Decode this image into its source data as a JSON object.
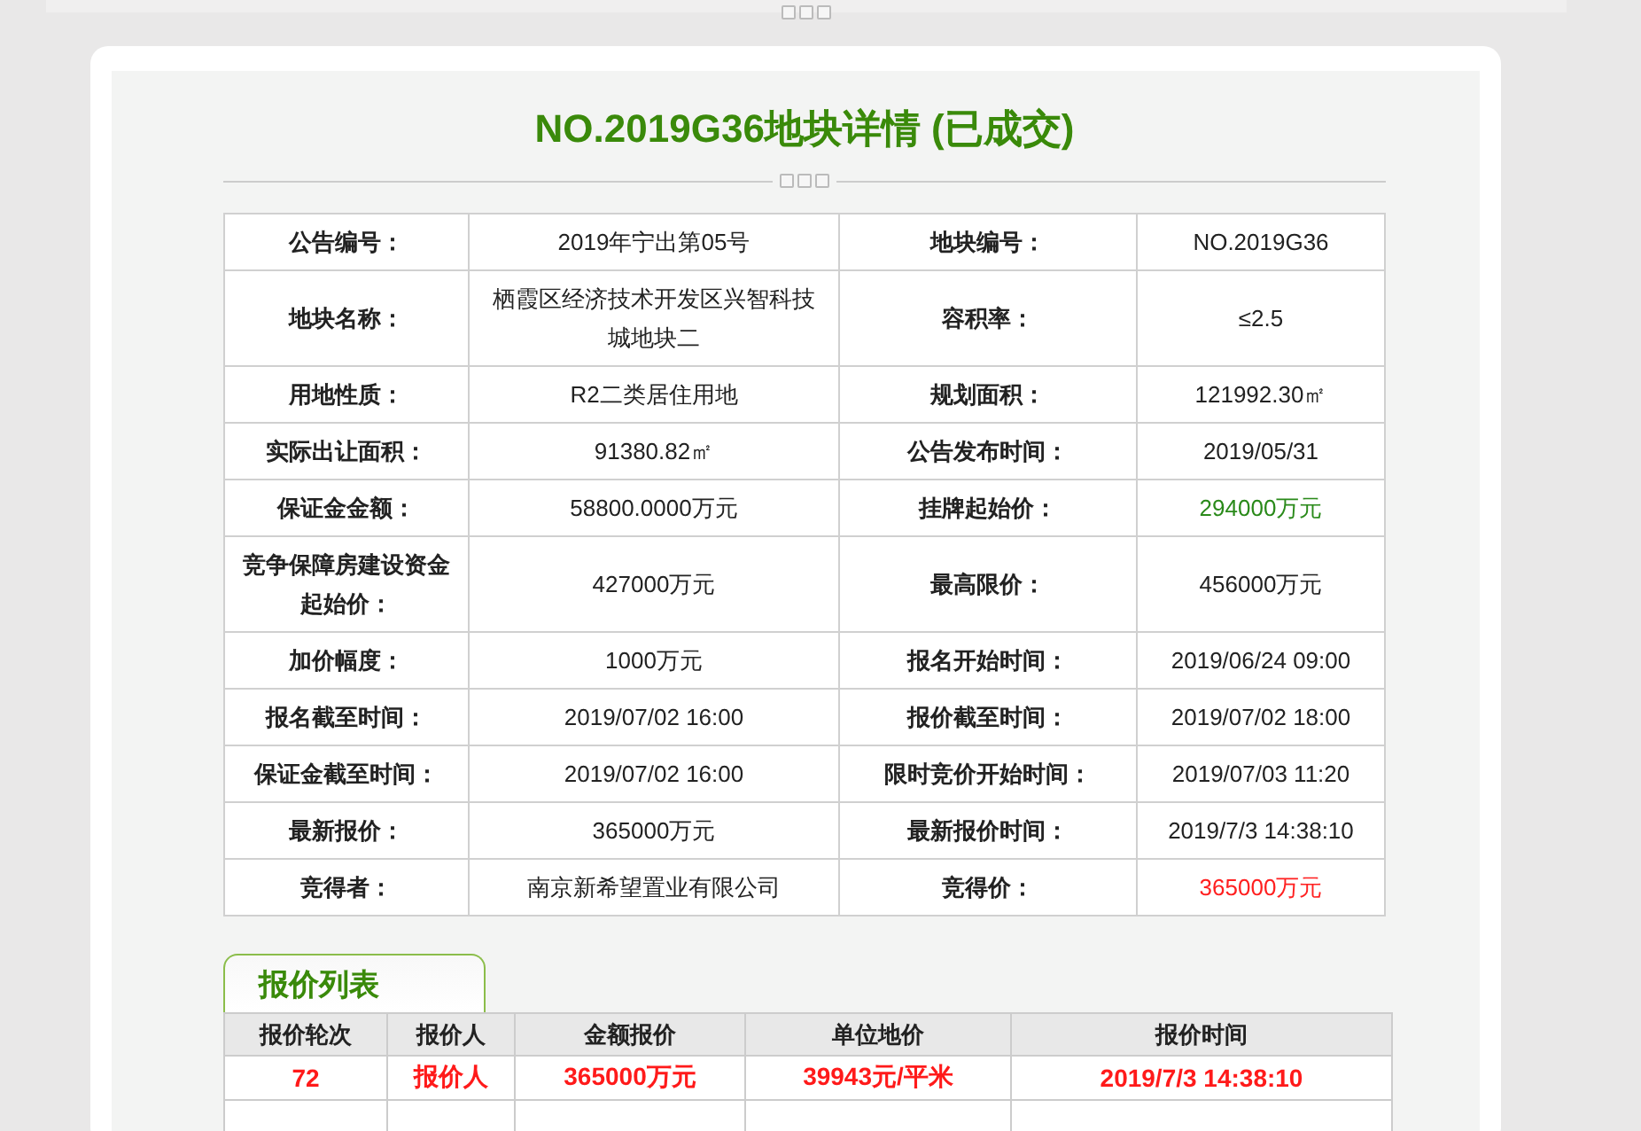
{
  "title": "NO.2019G36地块详情 (已成交)",
  "info_rows": [
    {
      "pairs": [
        {
          "label": "公告编号：",
          "value": "2019年宁出第05号"
        },
        {
          "label": "地块编号：",
          "value": "NO.2019G36"
        }
      ]
    },
    {
      "pairs": [
        {
          "label": "地块名称：",
          "value": "栖霞区经济技术开发区兴智科技城地块二"
        },
        {
          "label": "容积率：",
          "value": "≤2.5"
        }
      ]
    },
    {
      "pairs": [
        {
          "label": "用地性质：",
          "value": "R2二类居住用地"
        },
        {
          "label": "规划面积：",
          "value": "121992.30㎡"
        }
      ]
    },
    {
      "pairs": [
        {
          "label": "实际出让面积：",
          "value": "91380.82㎡"
        },
        {
          "label": "公告发布时间：",
          "value": "2019/05/31"
        }
      ]
    },
    {
      "pairs": [
        {
          "label": "保证金金额：",
          "value": "58800.0000万元"
        },
        {
          "label": "挂牌起始价：",
          "value": "294000万元",
          "color": "#2a8a1a"
        }
      ]
    },
    {
      "pairs": [
        {
          "label": "竞争保障房建设资金起始价：",
          "value": "427000万元"
        },
        {
          "label": "最高限价：",
          "value": "456000万元"
        }
      ]
    },
    {
      "pairs": [
        {
          "label": "加价幅度：",
          "value": "1000万元"
        },
        {
          "label": "报名开始时间：",
          "value": "2019/06/24 09:00"
        }
      ]
    },
    {
      "pairs": [
        {
          "label": "报名截至时间：",
          "value": "2019/07/02 16:00"
        },
        {
          "label": "报价截至时间：",
          "value": "2019/07/02 18:00"
        }
      ]
    },
    {
      "pairs": [
        {
          "label": "保证金截至时间：",
          "value": "2019/07/02 16:00"
        },
        {
          "label": "限时竞价开始时间：",
          "value": "2019/07/03 11:20"
        }
      ]
    },
    {
      "pairs": [
        {
          "label": "最新报价：",
          "value": "365000万元"
        },
        {
          "label": "最新报价时间：",
          "value": "2019/7/3 14:38:10"
        }
      ]
    },
    {
      "pairs": [
        {
          "label": "竞得者：",
          "value": "南京新希望置业有限公司"
        },
        {
          "label": "竞得价：",
          "value": "365000万元",
          "color": "#ff2020"
        }
      ]
    }
  ],
  "bid_list": {
    "tab": "报价列表",
    "columns": [
      "报价轮次",
      "报价人",
      "金额报价",
      "单位地价",
      "报价时间"
    ],
    "rows": [
      {
        "cells": [
          "72",
          "报价人",
          "365000万元",
          "39943元/平米",
          "2019/7/3 14:38:10"
        ]
      }
    ]
  }
}
